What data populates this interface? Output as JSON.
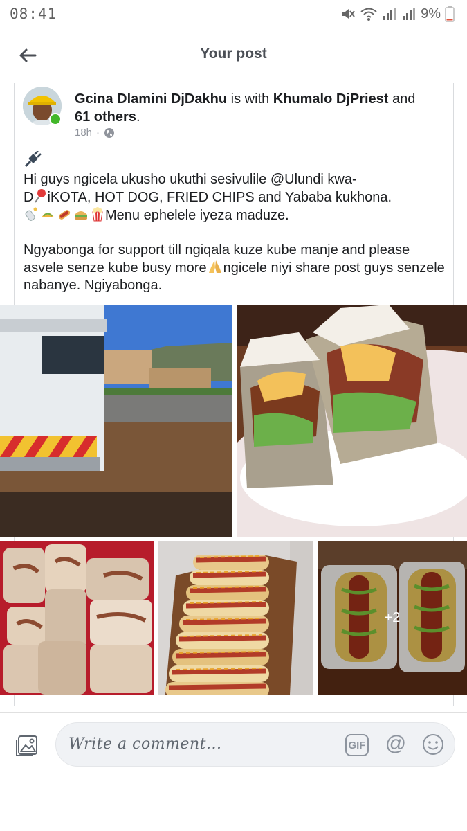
{
  "status_bar": {
    "time": "08:41",
    "battery": "9%"
  },
  "header": {
    "title": "Your post",
    "back_icon": "back-arrow-icon"
  },
  "post": {
    "author": "Gcina Dlamini DjDakhu",
    "with_text": " is with ",
    "tagged_person": "Khumalo DjPriest",
    "and_text": " and",
    "others": "61 others",
    "period": ".",
    "time": "18h",
    "separator": "·",
    "privacy_icon": "globe-icon",
    "text_line1": "Hi guys ngicela ukusho ukuthi sesivulile @Ulundi kwa-",
    "text_line2_a": "D",
    "text_line2_b": "iKOTA, HOT DOG, FRIED CHIPS and Yababa kukhona.",
    "text_line3": "Menu ephelele iyeza maduze.",
    "text_para2": "Ngyabonga for support till ngiqala kuze kube manje and please asvele senze kube busy more",
    "text_para2_b": "ngicele niyi share post guys senzele nabanye. Ngiyabonga.",
    "more_photos": "+2"
  },
  "comment_bar": {
    "placeholder": "Write a comment...",
    "gif_label": "GIF",
    "at_label": "@"
  },
  "colors": {
    "online": "#42b72a",
    "divider": "#d9dbde",
    "input_bg": "#f0f2f5"
  }
}
